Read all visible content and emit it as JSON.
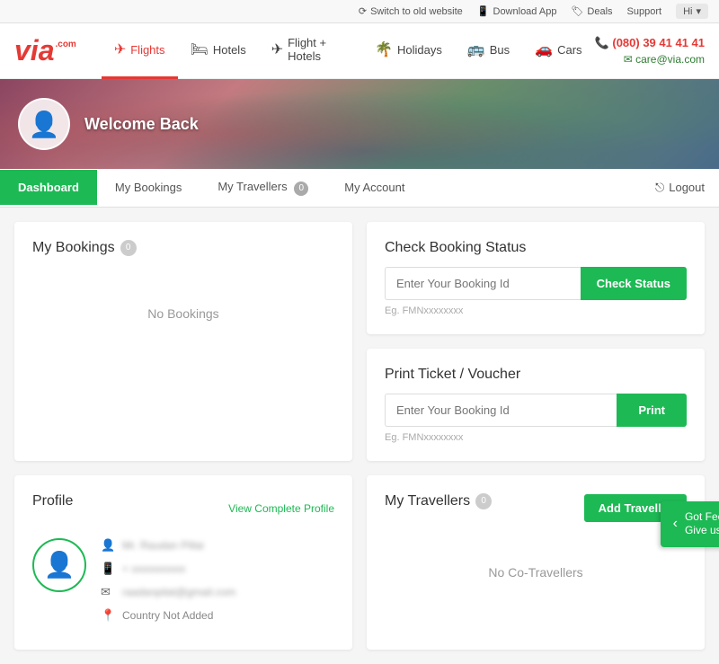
{
  "topbar": {
    "switch_label": "Switch to old website",
    "download_label": "Download App",
    "deals_label": "Deals",
    "support_label": "Support",
    "user_label": "Hi"
  },
  "header": {
    "logo_via": "via",
    "logo_com": ".com",
    "phone": "(080) 39 41 41 41",
    "email": "care@via.com",
    "nav": [
      {
        "label": "Flights",
        "icon": "✈",
        "active": true
      },
      {
        "label": "Hotels",
        "icon": "🛏"
      },
      {
        "label": "Flight + Hotels",
        "icon": "✈🛏"
      },
      {
        "label": "Holidays",
        "icon": "🌴"
      },
      {
        "label": "Bus",
        "icon": "🚌"
      },
      {
        "label": "Cars",
        "icon": "🚗"
      }
    ]
  },
  "hero": {
    "welcome": "Welcome Back"
  },
  "dashboard_tabs": [
    {
      "label": "Dashboard",
      "active": true
    },
    {
      "label": "My Bookings"
    },
    {
      "label": "My Travellers",
      "badge": "0"
    },
    {
      "label": "My Account"
    }
  ],
  "logout_label": "Logout",
  "my_bookings": {
    "title": "My Bookings",
    "count": "0",
    "empty_text": "No Bookings"
  },
  "check_booking_status": {
    "title": "Check Booking Status",
    "input_placeholder": "Enter Your Booking Id",
    "button_label": "Check Status",
    "eg_text": "Eg. FMNxxxxxxxx"
  },
  "print_ticket": {
    "title": "Print Ticket / Voucher",
    "input_placeholder": "Enter Your Booking Id",
    "button_label": "Print",
    "eg_text": "Eg. FMNxxxxxxxx"
  },
  "profile": {
    "title": "Profile",
    "view_complete": "View Complete Profile",
    "name": "Mr. Raudan Pillai",
    "phone": "+ xxxxxxxxxx",
    "email": "raadanpilat@gmail.com",
    "country": "Country Not Added"
  },
  "my_travellers": {
    "title": "My Travellers",
    "count": "0",
    "add_label": "Add Traveller",
    "empty_text": "No Co-Travellers"
  },
  "feedback": {
    "label": "Got FeedBack?",
    "sublabel": "Give us a rating"
  }
}
